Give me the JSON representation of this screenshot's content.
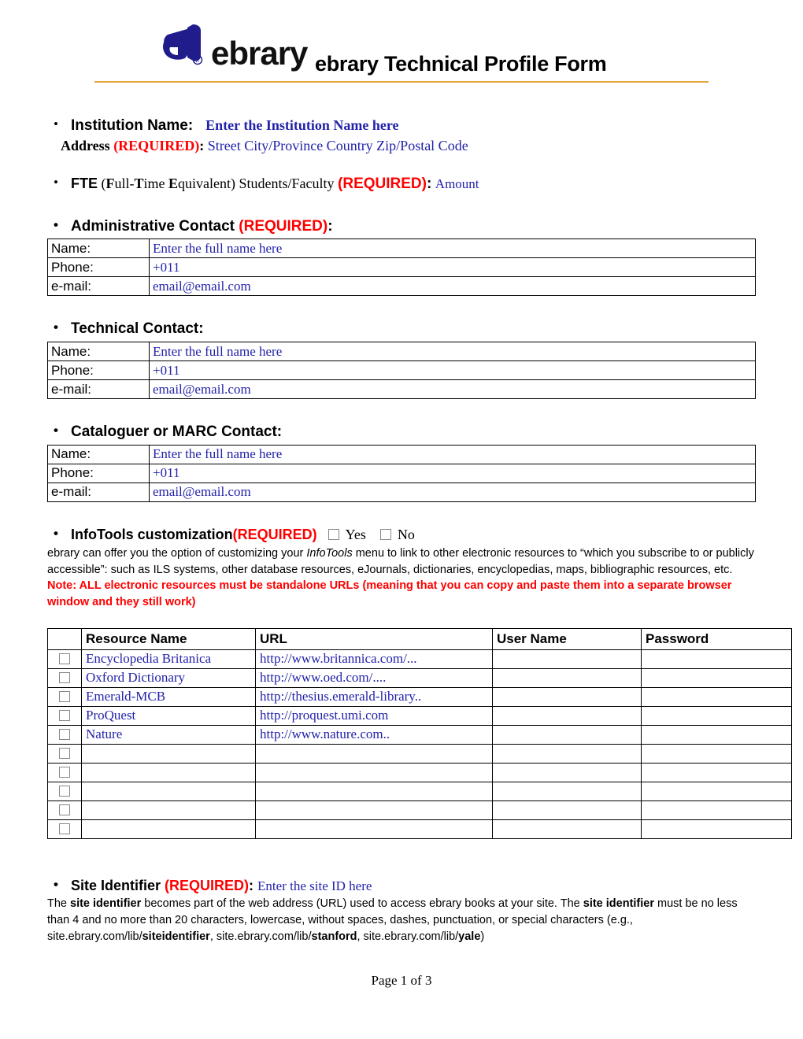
{
  "header": {
    "logo_word": "ebrary",
    "logo_mark": "ebrary-e-logo",
    "registered_mark": "®",
    "title": "ebrary Technical Profile Form"
  },
  "institution": {
    "label": "Institution Name:",
    "value": "Enter the Institution Name here",
    "address_label": "Address",
    "address_required": "(REQUIRED)",
    "address_colon": ":",
    "address_value": "Street  City/Province  Country   Zip/Postal Code"
  },
  "fte": {
    "abbr": "FTE",
    "expansion_pre": " (",
    "f": "F",
    "ull": "ull-",
    "t": "T",
    "ime": "ime ",
    "e": "E",
    "quivalent": "quivalent) Students/Faculty ",
    "required": "(REQUIRED)",
    "colon": ":",
    "amount": "Amount"
  },
  "admin_contact": {
    "heading": "Administrative Contact ",
    "required": "(REQUIRED)",
    "colon": ":",
    "rows": [
      {
        "label": "Name:",
        "value": "Enter the full name here"
      },
      {
        "label": "Phone:",
        "value": "+011"
      },
      {
        "label": "e-mail:",
        "value": "email@email.com"
      }
    ]
  },
  "technical_contact": {
    "heading": "Technical Contact:",
    "rows": [
      {
        "label": "Name:",
        "value": "Enter the full name here"
      },
      {
        "label": "Phone:",
        "value": "+011"
      },
      {
        "label": "e-mail:",
        "value": "email@email.com"
      }
    ]
  },
  "cataloguer_contact": {
    "heading": "Cataloguer or MARC Contact:",
    "rows": [
      {
        "label": "Name:",
        "value": "Enter the full name here"
      },
      {
        "label": "Phone:",
        "value": "+011"
      },
      {
        "label": "e-mail:",
        "value": "email@email.com"
      }
    ]
  },
  "infotools": {
    "heading": "InfoTools customization ",
    "required": "(REQUIRED)",
    "yes_label": "Yes",
    "no_label": "No",
    "body_1": "ebrary can offer you the option of customizing your ",
    "body_italic": "InfoTools",
    "body_2": " menu to link to other electronic resources to “which you subscribe to or publicly accessible”: such as ILS systems, other database resources, eJournals, dictionaries, encyclopedias, maps, bibliographic resources, etc.  ",
    "note": "Note: ALL electronic resources must be standalone URLs (meaning that you can copy and paste them into a separate browser window and they still work)"
  },
  "resource_table": {
    "columns": [
      "",
      "Resource Name",
      "URL",
      "User Name",
      "Password"
    ],
    "rows": [
      {
        "name": "Encyclopedia Britanica",
        "url": "http://www.britannica.com/...",
        "user": "",
        "password": ""
      },
      {
        "name": "Oxford Dictionary",
        "url": "http://www.oed.com/....",
        "user": "",
        "password": ""
      },
      {
        "name": "Emerald-MCB",
        "url": "http://thesius.emerald-library..",
        "user": "",
        "password": ""
      },
      {
        "name": "ProQuest",
        "url": "http://proquest.umi.com",
        "user": "",
        "password": ""
      },
      {
        "name": "Nature",
        "url": "http://www.nature.com..",
        "user": "",
        "password": ""
      },
      {
        "name": "",
        "url": "",
        "user": "",
        "password": ""
      },
      {
        "name": "",
        "url": "",
        "user": "",
        "password": ""
      },
      {
        "name": "",
        "url": "",
        "user": "",
        "password": ""
      },
      {
        "name": "",
        "url": "",
        "user": "",
        "password": ""
      },
      {
        "name": "",
        "url": "",
        "user": "",
        "password": ""
      }
    ]
  },
  "site_identifier": {
    "heading": "Site Identifier ",
    "required": "(REQUIRED)",
    "colon": ":",
    "value": "Enter the site ID here",
    "body_1": "The ",
    "body_b1": "site identifier",
    "body_2": " becomes part of the web address (URL) used to access ebrary books at your site.  The ",
    "body_b2": "site identifier",
    "body_3": " must be no less than 4 and no more than 20 characters, lowercase, without spaces, dashes, punctuation, or special characters (e.g., site.ebrary.com/lib/",
    "body_b3": "siteidentifier",
    "body_4": ", site.ebrary.com/lib/",
    "body_b4": "stanford",
    "body_5": ", site.ebrary.com/lib/",
    "body_b5": "yale",
    "body_6": ")"
  },
  "footer": {
    "page_text": "Page 1 of 3"
  },
  "colors": {
    "logo_blue": "#201C8C",
    "rule_orange": "#E8A33D",
    "required_red": "#FF0000",
    "value_blue": "#2222AA"
  }
}
